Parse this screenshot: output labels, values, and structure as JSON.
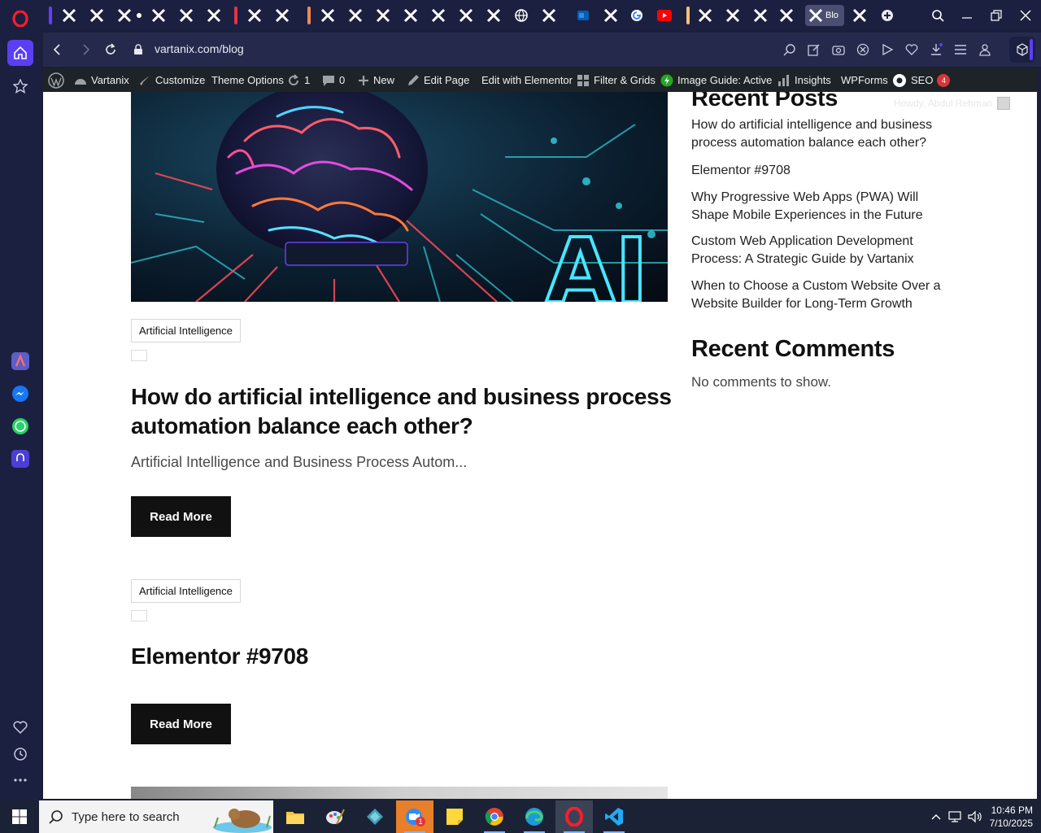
{
  "browser": {
    "url": "vartanix.com/blog",
    "active_tab_label": "Blo"
  },
  "wp_admin_bar": {
    "site_name": "Vartanix",
    "customize": "Customize",
    "theme_options": "Theme Options",
    "updates_count": "1",
    "comments_count": "0",
    "new": "New",
    "edit_page": "Edit Page",
    "edit_with_elementor": "Edit with Elementor",
    "filter_grids": "Filter & Grids",
    "image_guide": "Image Guide: Active",
    "insights": "Insights",
    "wpforms": "WPForms",
    "seo": "SEO",
    "seo_badge": "4",
    "howdy": "Howdy, Abdul Rehman"
  },
  "posts": [
    {
      "category": "Artificial Intelligence",
      "title": "How do artificial intelligence and business process automation balance each other?",
      "excerpt": "Artificial Intelligence and Business Process Autom...",
      "read_more": "Read More",
      "image_text": "AI"
    },
    {
      "category": "Artificial Intelligence",
      "title": "Elementor #9708",
      "read_more": "Read More"
    }
  ],
  "sidebar_widgets": {
    "recent_posts_heading": "Recent Posts",
    "recent_posts": [
      "How do artificial intelligence and business process automation balance each other?",
      "Elementor #9708",
      "Why Progressive Web Apps (PWA) Will Shape Mobile Experiences in the Future",
      "Custom Web Application Development Process: A Strategic Guide by Vartanix",
      "When to Choose a Custom Website Over a Website Builder for Long-Term Growth"
    ],
    "recent_comments_heading": "Recent Comments",
    "no_comments": "No comments to show."
  },
  "taskbar": {
    "search_placeholder": "Type here to search",
    "time": "10:46 PM",
    "date": "7/10/2025",
    "zoom_badge": "1"
  },
  "colors": {
    "browser_chrome": "#1c2040",
    "accent": "#5a3ff5",
    "wp_bar": "#1d2327",
    "button": "#111111"
  }
}
